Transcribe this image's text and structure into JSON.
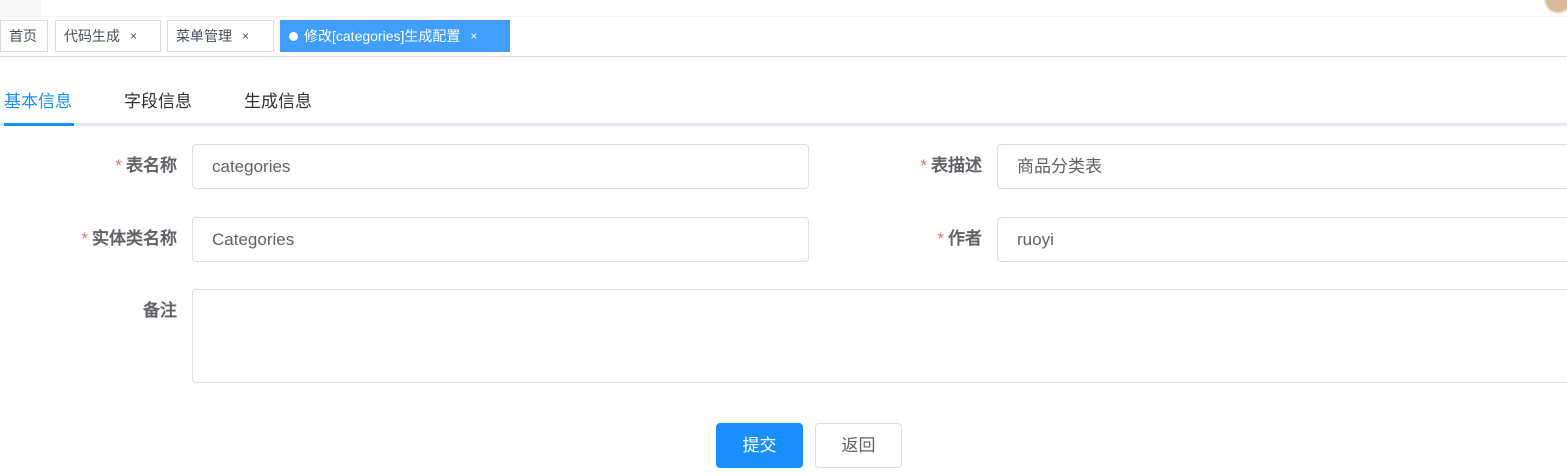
{
  "tags": {
    "home": "首页",
    "codegen": "代码生成",
    "menu": "菜单管理",
    "current": "修改[categories]生成配置",
    "close_glyph": "×"
  },
  "tabs": [
    {
      "label": "基本信息",
      "active": true
    },
    {
      "label": "字段信息",
      "active": false
    },
    {
      "label": "生成信息",
      "active": false
    }
  ],
  "form": {
    "required_mark": "*",
    "table_name": {
      "label": "表名称",
      "value": "categories"
    },
    "table_comment": {
      "label": "表描述",
      "value": "商品分类表"
    },
    "class_name": {
      "label": "实体类名称",
      "value": "Categories"
    },
    "author": {
      "label": "作者",
      "value": "ruoyi"
    },
    "remark": {
      "label": "备注",
      "value": ""
    }
  },
  "buttons": {
    "submit": "提交",
    "back": "返回"
  },
  "colors": {
    "primary": "#1890ff",
    "tag_active": "#409eff",
    "required": "#f56c6c"
  }
}
